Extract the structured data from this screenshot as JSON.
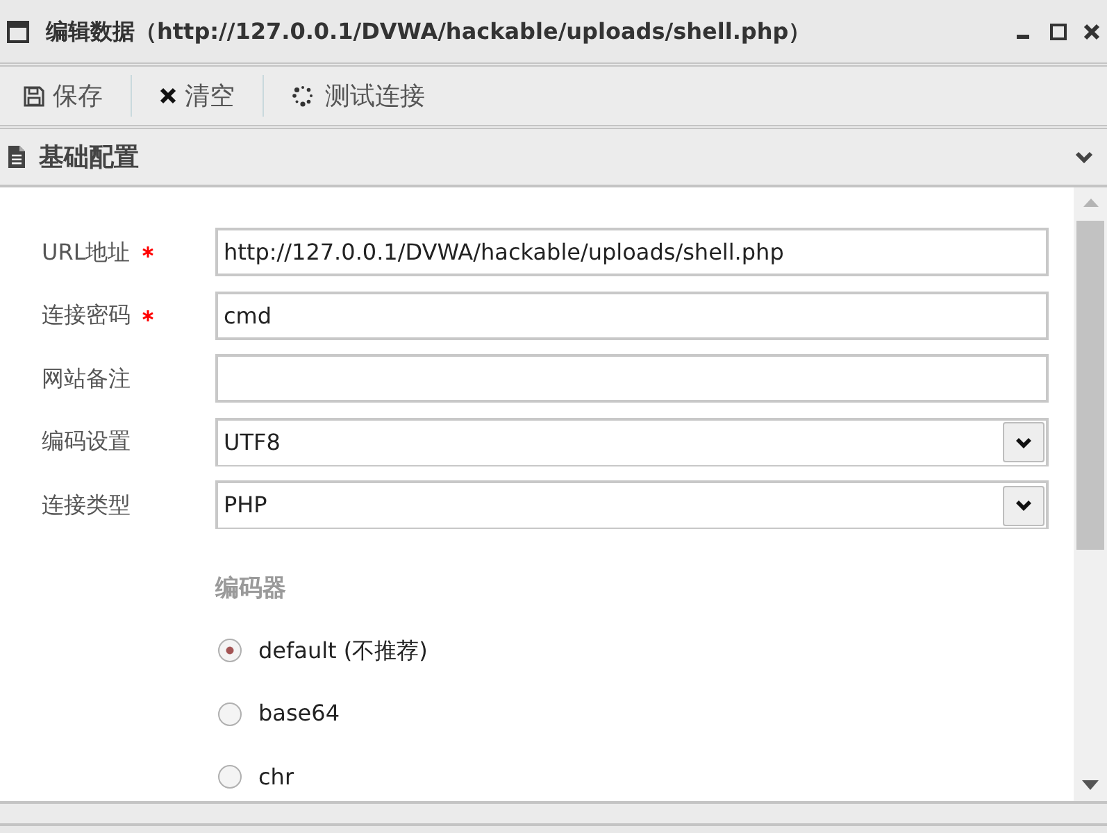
{
  "window": {
    "title": "编辑数据（http://127.0.0.1/DVWA/hackable/uploads/shell.php）"
  },
  "toolbar": [
    {
      "kind": "save",
      "label": "保存"
    },
    {
      "kind": "clear",
      "label": "清空"
    },
    {
      "kind": "test",
      "label": "测试连接"
    }
  ],
  "panel": {
    "title": "基础配置",
    "expanded": true,
    "fields": [
      {
        "kind": "text",
        "label": "URL地址",
        "required": true,
        "value": "http://127.0.0.1/DVWA/hackable/uploads/shell.php"
      },
      {
        "kind": "text",
        "label": "连接密码",
        "required": true,
        "value": "cmd"
      },
      {
        "kind": "text",
        "label": "网站备注",
        "required": false
      },
      {
        "kind": "select",
        "label": "编码设置",
        "required": false,
        "value": "UTF8"
      },
      {
        "kind": "select",
        "label": "连接类型",
        "required": false,
        "value": "PHP"
      }
    ],
    "encoder": {
      "title": "编码器",
      "options": [
        {
          "label": "default (不推荐)",
          "selected": true
        },
        {
          "label": "base64",
          "selected": false
        },
        {
          "label": "chr",
          "selected": false
        }
      ]
    }
  }
}
